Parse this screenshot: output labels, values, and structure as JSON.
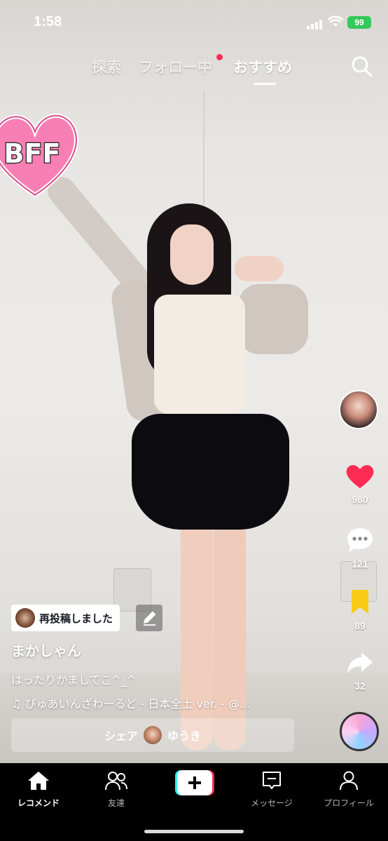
{
  "status_bar": {
    "time": "1:58",
    "battery": "99"
  },
  "top_nav": {
    "tabs": [
      {
        "label": "探索"
      },
      {
        "label": "フォロー中"
      },
      {
        "label": "おすすめ"
      }
    ],
    "active_tab": "おすすめ"
  },
  "sticker": {
    "text": "BFF"
  },
  "right_rail": {
    "like_count": "980",
    "comment_count": "121",
    "bookmark_count": "89",
    "share_count": "32"
  },
  "caption_area": {
    "repost_label": "再投稿しました",
    "username": "まかしゃん",
    "caption": "はったりかましてこ^_^",
    "music": "ぴゅあいんざわーるど - 日本全土 ver. - @..."
  },
  "share_bar": {
    "label": "シェア",
    "friend_name": "ゆうき"
  },
  "bottom_nav": {
    "items": [
      {
        "label": "レコメンド",
        "icon": "home-icon"
      },
      {
        "label": "友達",
        "icon": "friends-icon"
      },
      {
        "label": "",
        "icon": "create-plus-icon"
      },
      {
        "label": "メッセージ",
        "icon": "inbox-icon"
      },
      {
        "label": "プロフィール",
        "icon": "profile-icon"
      }
    ]
  },
  "colors": {
    "like": "#fe2c55",
    "bookmark": "#facc15",
    "battery": "#34c759"
  }
}
